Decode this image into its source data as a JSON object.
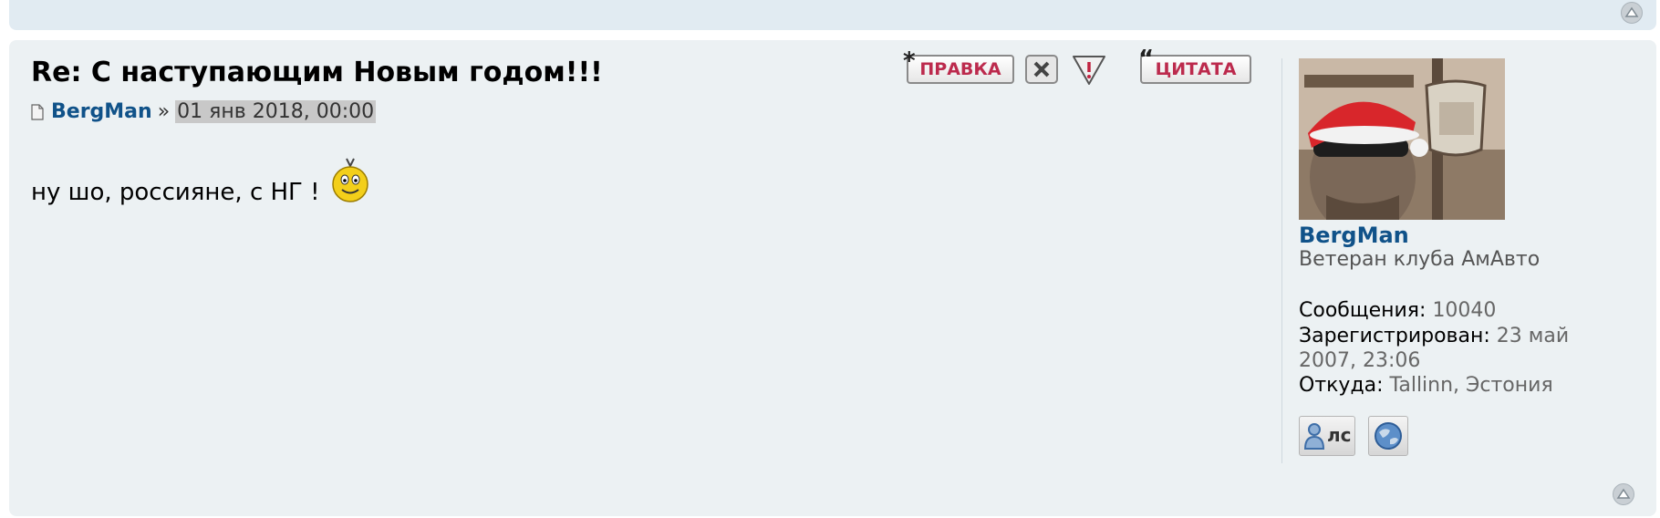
{
  "post": {
    "title": "Re: С наступающим Новым годом!!!",
    "author": "BergMan",
    "separator": "»",
    "date": "01 янв 2018, 00:00",
    "content_text": "ну шо, россияне, с НГ !"
  },
  "actions": {
    "edit_label": "ПРАВКА",
    "quote_label": "ЦИТАТА"
  },
  "profile": {
    "name": "BergMan",
    "rank": "Ветеран клуба АмАвто",
    "posts_label": "Сообщения:",
    "posts_value": "10040",
    "registered_label": "Зарегистрирован:",
    "registered_value_line1": "23 май",
    "registered_value_line2": "2007, 23:06",
    "location_label": "Откуда:",
    "location_value": "Tallinn, Эстония",
    "pm_label": "лс"
  },
  "colors": {
    "post_bg": "#ecf1f3",
    "link": "#105289",
    "button_text": "#bc2a4d"
  },
  "icons": {
    "post_icon": "document-icon",
    "smiley": "smiley-icon",
    "delete": "close-icon",
    "report": "warning-icon",
    "pm": "user-icon",
    "website": "globe-icon",
    "top": "arrow-up-icon"
  }
}
